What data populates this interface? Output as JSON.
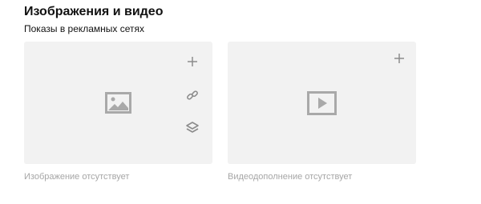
{
  "section": {
    "title": "Изображения и видео",
    "subtitle": "Показы в рекламных сетях"
  },
  "image_card": {
    "placeholder_icon": "image-placeholder-icon",
    "actions": [
      "plus-icon",
      "link-icon",
      "layers-icon"
    ],
    "caption": "Изображение отсутствует"
  },
  "video_card": {
    "placeholder_icon": "video-placeholder-icon",
    "actions": [
      "plus-icon"
    ],
    "caption": "Видеодополнение отсутствует"
  },
  "colors": {
    "card_background": "#f2f2f2",
    "icon": "#8c8c8c",
    "placeholder_icon": "#a9a9a9",
    "caption_text": "#a6a6a6"
  }
}
